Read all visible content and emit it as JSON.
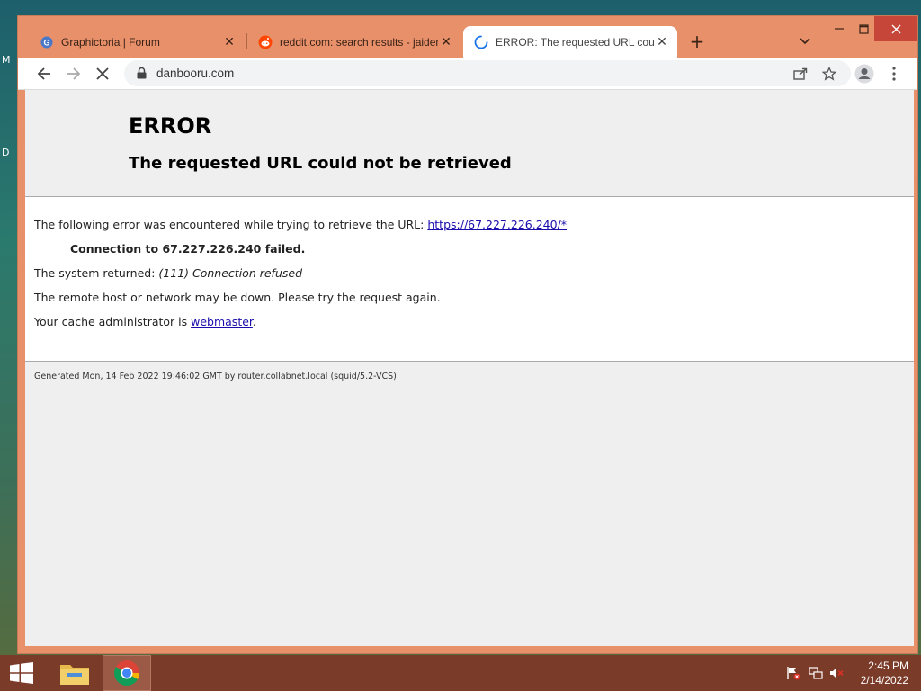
{
  "desktop": {
    "edge_labels": [
      "M",
      "D"
    ]
  },
  "tabs": [
    {
      "title": "Graphictoria | Forum",
      "favicon": "graphictoria-icon"
    },
    {
      "title": "reddit.com: search results - jaiden",
      "favicon": "reddit-icon"
    },
    {
      "title": "ERROR: The requested URL could not be retrieved",
      "favicon": "loading-spinner-icon"
    }
  ],
  "toolbar": {
    "url": "danbooru.com"
  },
  "error_page": {
    "heading": "ERROR",
    "subheading": "The requested URL could not be retrieved",
    "encounter_text": "The following error was encountered while trying to retrieve the URL: ",
    "encounter_link": "https://67.227.226.240/*",
    "failure": "Connection to 67.227.226.240 failed.",
    "returned_label": "The system returned: ",
    "returned_value": "(111) Connection refused",
    "remote_text": "The remote host or network may be down. Please try the request again.",
    "admin_text": "Your cache administrator is ",
    "admin_link": "webmaster",
    "admin_suffix": ".",
    "footer": "Generated Mon, 14 Feb 2022 19:46:02 GMT by router.collabnet.local (squid/5.2-VCS)"
  },
  "taskbar": {
    "time": "2:45 PM",
    "date": "2/14/2022"
  },
  "colors": {
    "window_frame": "#e8906a",
    "taskbar": "#7a3b29",
    "link": "#1a0dab",
    "close_button": "#c6473a"
  }
}
